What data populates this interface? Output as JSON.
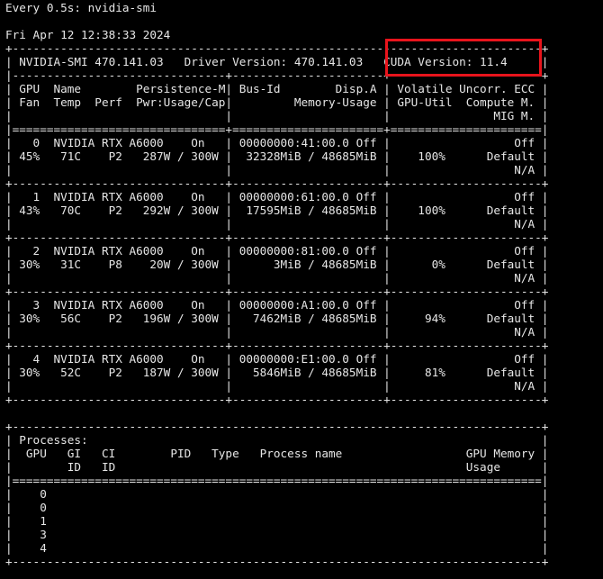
{
  "terminal": {
    "lines": [
      "Every 0.5s: nvidia-smi",
      "",
      "Fri Apr 12 12:38:33 2024",
      "+-----------------------------------------------------------------------------+",
      "| NVIDIA-SMI 470.141.03   Driver Version: 470.141.03   CUDA Version: 11.4     |",
      "|-------------------------------+----------------------+----------------------+",
      "| GPU  Name        Persistence-M| Bus-Id        Disp.A | Volatile Uncorr. ECC |",
      "| Fan  Temp  Perf  Pwr:Usage/Cap|         Memory-Usage | GPU-Util  Compute M. |",
      "|                               |                      |               MIG M. |",
      "|===============================+======================+======================|",
      "|   0  NVIDIA RTX A6000    On   | 00000000:41:00.0 Off |                  Off |",
      "| 45%   71C    P2   287W / 300W |  32328MiB / 48685MiB |    100%      Default |",
      "|                               |                      |                  N/A |",
      "+-------------------------------+----------------------+----------------------+",
      "|   1  NVIDIA RTX A6000    On   | 00000000:61:00.0 Off |                  Off |",
      "| 43%   70C    P2   292W / 300W |  17595MiB / 48685MiB |    100%      Default |",
      "|                               |                      |                  N/A |",
      "+-------------------------------+----------------------+----------------------+",
      "|   2  NVIDIA RTX A6000    On   | 00000000:81:00.0 Off |                  Off |",
      "| 30%   31C    P8    20W / 300W |      3MiB / 48685MiB |      0%      Default |",
      "|                               |                      |                  N/A |",
      "+-------------------------------+----------------------+----------------------+",
      "|   3  NVIDIA RTX A6000    On   | 00000000:A1:00.0 Off |                  Off |",
      "| 30%   56C    P2   196W / 300W |   7462MiB / 48685MiB |     94%      Default |",
      "|                               |                      |                  N/A |",
      "+-------------------------------+----------------------+----------------------+",
      "|   4  NVIDIA RTX A6000    On   | 00000000:E1:00.0 Off |                  Off |",
      "| 30%   52C    P2   187W / 300W |   5846MiB / 48685MiB |     81%      Default |",
      "|                               |                      |                  N/A |",
      "+-------------------------------+----------------------+----------------------+",
      "",
      "+-----------------------------------------------------------------------------+",
      "| Processes:                                                                  |",
      "|  GPU   GI   CI        PID   Type   Process name                  GPU Memory |",
      "|        ID   ID                                                   Usage      |",
      "|=============================================================================|",
      "|    0                                                                        |",
      "|    0                                                                        |",
      "|    1                                                                        |",
      "|    3                                                                        |",
      "|    4                                                                        |",
      "+-----------------------------------------------------------------------------+"
    ]
  },
  "colors": {
    "background": "#000000",
    "foreground": "#e6e6e6",
    "highlight_box": "#e8141c"
  }
}
